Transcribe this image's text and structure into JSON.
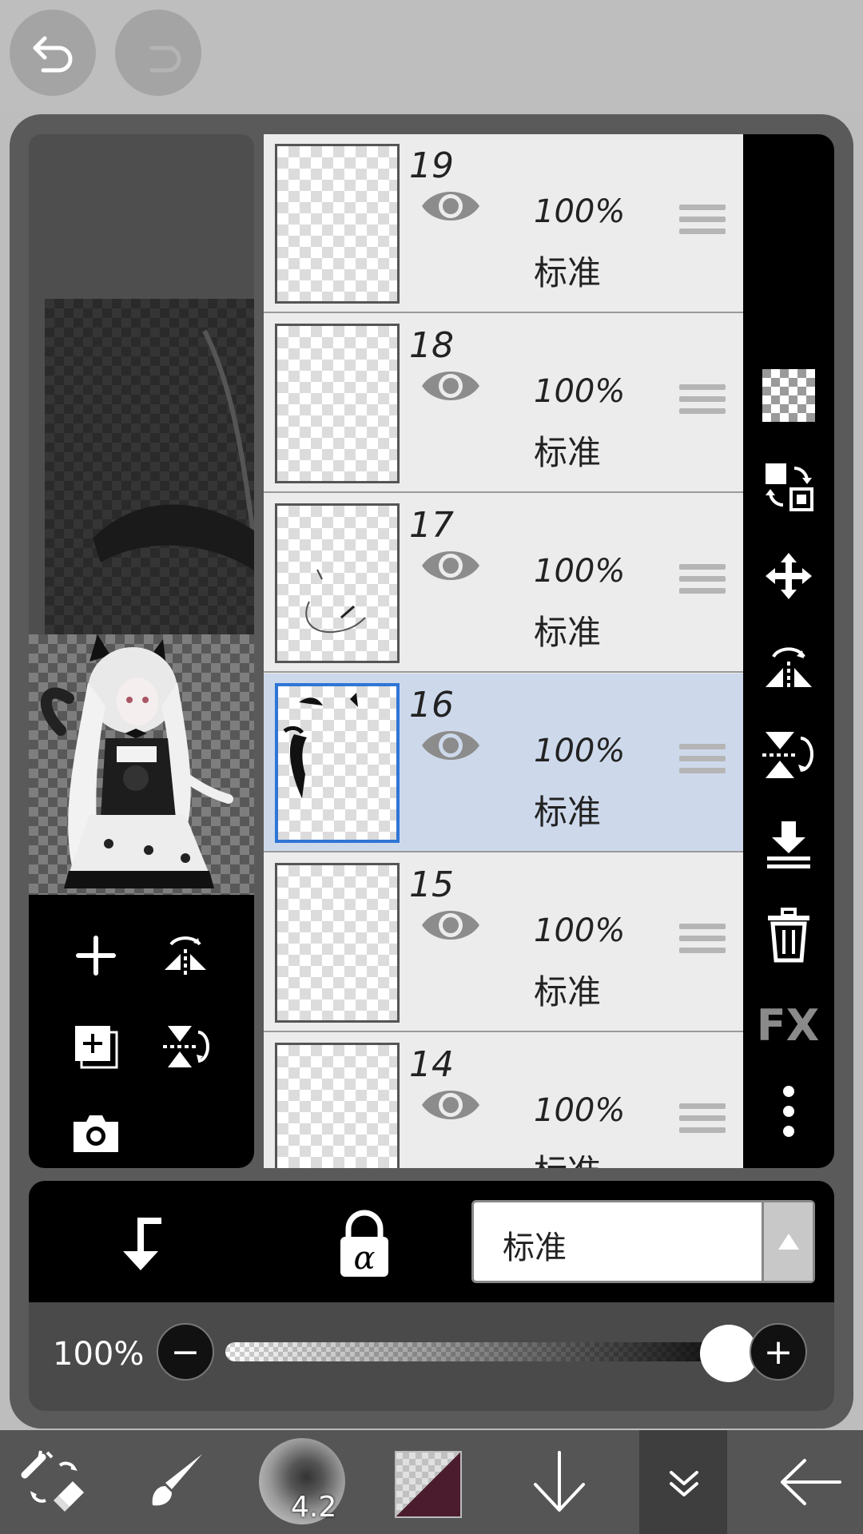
{
  "top_bar": {
    "undo_icon": "undo-arrow-icon",
    "redo_icon": "redo-arrow-icon"
  },
  "layers": [
    {
      "number": "19",
      "opacity": "100%",
      "blend": "标准",
      "visible": true,
      "selected": false
    },
    {
      "number": "18",
      "opacity": "100%",
      "blend": "标准",
      "visible": true,
      "selected": false
    },
    {
      "number": "17",
      "opacity": "100%",
      "blend": "标准",
      "visible": true,
      "selected": false
    },
    {
      "number": "16",
      "opacity": "100%",
      "blend": "标准",
      "visible": true,
      "selected": true
    },
    {
      "number": "15",
      "opacity": "100%",
      "blend": "标准",
      "visible": true,
      "selected": false
    },
    {
      "number": "14",
      "opacity": "100%",
      "blend": "标准",
      "visible": true,
      "selected": false
    }
  ],
  "left_tools": [
    "add-layer-icon",
    "flip-horizontal-icon",
    "duplicate-layer-icon",
    "flip-vertical-icon",
    "camera-icon"
  ],
  "right_tools": [
    "transparency-icon",
    "swap-icon",
    "move-icon",
    "flip-horizontal-icon",
    "flip-vertical-icon",
    "merge-down-icon",
    "trash-icon",
    "fx-icon",
    "more-icon"
  ],
  "fx_label": "FX",
  "blend_bar": {
    "clip_icon": "clipping-arrow-icon",
    "alpha_lock_icon": "alpha-lock-icon",
    "blend_mode": "标准"
  },
  "opacity_slider": {
    "label": "100%",
    "value": 1.0,
    "minus": "−",
    "plus": "+"
  },
  "bottom_bar": {
    "brush_size": "4.2",
    "primary_color": "#4a1c2e",
    "icons": [
      "tools-icon",
      "brush-icon",
      "brush-size-icon",
      "color-icon",
      "download-icon",
      "layers-icon",
      "back-icon"
    ]
  },
  "colors": {
    "selected_layer_bg": "#cdd9eb",
    "selected_border": "#2f75d6",
    "panel_bg": "#5a5a5a"
  }
}
